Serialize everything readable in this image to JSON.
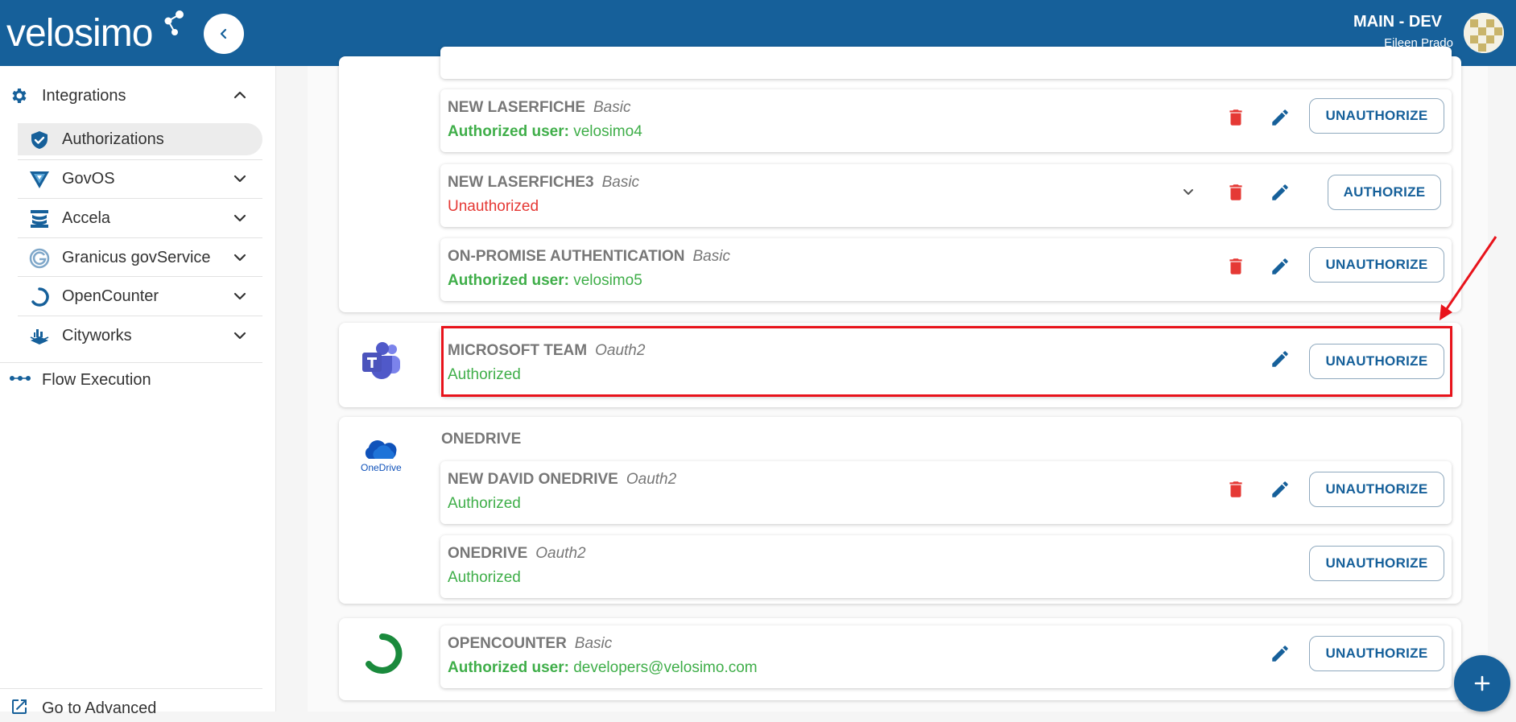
{
  "header": {
    "logo": "velosimo",
    "env": "MAIN - DEV",
    "user": "Eileen Prado"
  },
  "sidebar": {
    "group_label": "Integrations",
    "items": [
      {
        "label": "Authorizations",
        "icon": "shield-check-icon",
        "active": true
      },
      {
        "label": "GovOS",
        "icon": "govos-icon"
      },
      {
        "label": "Accela",
        "icon": "accela-icon"
      },
      {
        "label": "Granicus govService",
        "icon": "granicus-icon"
      },
      {
        "label": "OpenCounter",
        "icon": "opencounter-icon"
      },
      {
        "label": "Cityworks",
        "icon": "cityworks-icon"
      }
    ],
    "flow_label": "Flow Execution",
    "advanced_label": "Go to Advanced"
  },
  "entries": {
    "laserfiche": {
      "name": "NEW LASERFICHE",
      "type": "Basic",
      "status_prefix": "Authorized user:",
      "status_value": "velosimo4",
      "action": "UNAUTHORIZE"
    },
    "laserfiche3": {
      "name": "NEW LASERFICHE3",
      "type": "Basic",
      "status": "Unauthorized",
      "action": "AUTHORIZE"
    },
    "onpromise": {
      "name": "ON-PROMISE AUTHENTICATION",
      "type": "Basic",
      "status_prefix": "Authorized user:",
      "status_value": "velosimo5",
      "action": "UNAUTHORIZE"
    },
    "msteam": {
      "name": "MICROSOFT TEAM",
      "type": "Oauth2",
      "status": "Authorized",
      "action": "UNAUTHORIZE"
    },
    "onedrive_section": "ONEDRIVE",
    "onedrive_logo_text": "OneDrive",
    "david_onedrive": {
      "name": "NEW DAVID ONEDRIVE",
      "type": "Oauth2",
      "status": "Authorized",
      "action": "UNAUTHORIZE"
    },
    "onedrive": {
      "name": "ONEDRIVE",
      "type": "Oauth2",
      "status": "Authorized",
      "action": "UNAUTHORIZE"
    },
    "opencounter": {
      "name": "OPENCOUNTER",
      "type": "Basic",
      "status_prefix": "Authorized user:",
      "status_value": "developers@velosimo.com",
      "action": "UNAUTHORIZE"
    }
  },
  "colors": {
    "brand": "#16609a",
    "authorized": "#3fae49",
    "unauthorized": "#e53935",
    "highlight": "#e8131b"
  }
}
